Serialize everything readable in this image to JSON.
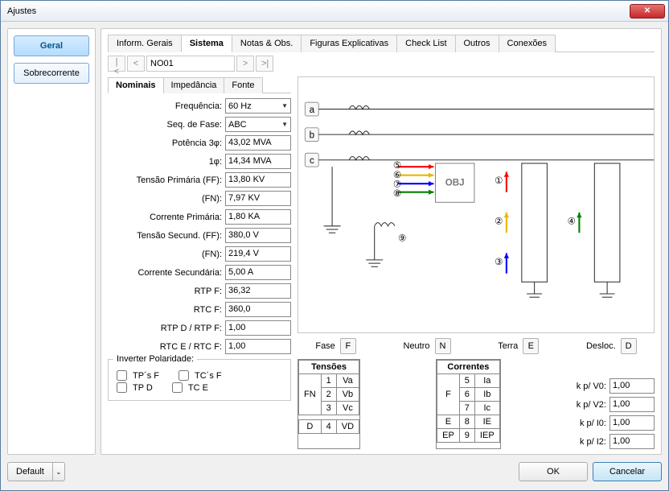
{
  "window": {
    "title": "Ajustes"
  },
  "sidebar": {
    "items": [
      {
        "label": "Geral",
        "active": true
      },
      {
        "label": "Sobrecorrente",
        "active": false
      }
    ]
  },
  "nav": {
    "record": "NO01"
  },
  "tabs": {
    "items": [
      {
        "label": "Inform. Gerais"
      },
      {
        "label": "Sistema"
      },
      {
        "label": "Notas & Obs."
      },
      {
        "label": "Figuras Explicativas"
      },
      {
        "label": "Check List"
      },
      {
        "label": "Outros"
      },
      {
        "label": "Conexões"
      }
    ],
    "active": 1
  },
  "subtabs": {
    "items": [
      {
        "label": "Nominais"
      },
      {
        "label": "Impedância"
      },
      {
        "label": "Fonte"
      }
    ],
    "active": 0
  },
  "form": {
    "frequencia": {
      "label": "Frequência:",
      "value": "60 Hz"
    },
    "seq_fase": {
      "label": "Seq. de Fase:",
      "value": "ABC"
    },
    "potencia_3f": {
      "label": "Potência 3φ:",
      "value": "43,02 MVA"
    },
    "potencia_1f": {
      "label": "1φ:",
      "value": "14,34 MVA"
    },
    "tensao_prim_ff": {
      "label": "Tensão Primária (FF):",
      "value": "13,80 KV"
    },
    "tensao_prim_fn": {
      "label": "(FN):",
      "value": "7,97 KV"
    },
    "corrente_prim": {
      "label": "Corrente Primária:",
      "value": "1,80 KA"
    },
    "tensao_sec_ff": {
      "label": "Tensão Secund. (FF):",
      "value": "380,0 V"
    },
    "tensao_sec_fn": {
      "label": "(FN):",
      "value": "219,4 V"
    },
    "corrente_sec": {
      "label": "Corrente Secundária:",
      "value": "5,00 A"
    },
    "rtp_f": {
      "label": "RTP F:",
      "value": "36,32"
    },
    "rtc_f": {
      "label": "RTC F:",
      "value": "360,0"
    },
    "rtp_d_f": {
      "label": "RTP D / RTP F:",
      "value": "1,00"
    },
    "rtc_e_f": {
      "label": "RTC E / RTC F:",
      "value": "1,00"
    }
  },
  "invert": {
    "title": "Inverter Polaridade:",
    "tps_f": "TP´s F",
    "tcs_f": "TC´s F",
    "tp_d": "TP D",
    "tc_e": "TC E"
  },
  "diagram": {
    "terminals": [
      "a",
      "b",
      "c"
    ],
    "obj_label": "OBJ",
    "markers": [
      "①",
      "②",
      "③",
      "④",
      "⑤",
      "⑥",
      "⑦",
      "⑧",
      "⑨"
    ]
  },
  "legend": {
    "fase": {
      "label": "Fase",
      "btn": "F"
    },
    "neutro": {
      "label": "Neutro",
      "btn": "N"
    },
    "terra": {
      "label": "Terra",
      "btn": "E"
    },
    "desloc": {
      "label": "Desloc.",
      "btn": "D"
    }
  },
  "tensoes": {
    "title": "Tensões",
    "left_header": "FN",
    "d_label": "D",
    "rows": [
      {
        "n": "1",
        "v": "Va"
      },
      {
        "n": "2",
        "v": "Vb"
      },
      {
        "n": "3",
        "v": "Vc"
      }
    ],
    "d_row": {
      "n": "4",
      "v": "VD"
    }
  },
  "correntes": {
    "title": "Correntes",
    "left_f": "F",
    "left_e": "E",
    "left_ep": "EP",
    "rows_f": [
      {
        "n": "5",
        "v": "Ia"
      },
      {
        "n": "6",
        "v": "Ib"
      },
      {
        "n": "7",
        "v": "Ic"
      }
    ],
    "row_e": {
      "n": "8",
      "v": "IE"
    },
    "row_ep": {
      "n": "9",
      "v": "IEP"
    }
  },
  "k": {
    "v0": {
      "label": "k p/ V0:",
      "value": "1,00"
    },
    "v2": {
      "label": "k p/ V2:",
      "value": "1,00"
    },
    "i0": {
      "label": "k p/ I0:",
      "value": "1,00"
    },
    "i2": {
      "label": "k p/ I2:",
      "value": "1,00"
    }
  },
  "footer": {
    "default": "Default",
    "ok": "OK",
    "cancel": "Cancelar"
  }
}
